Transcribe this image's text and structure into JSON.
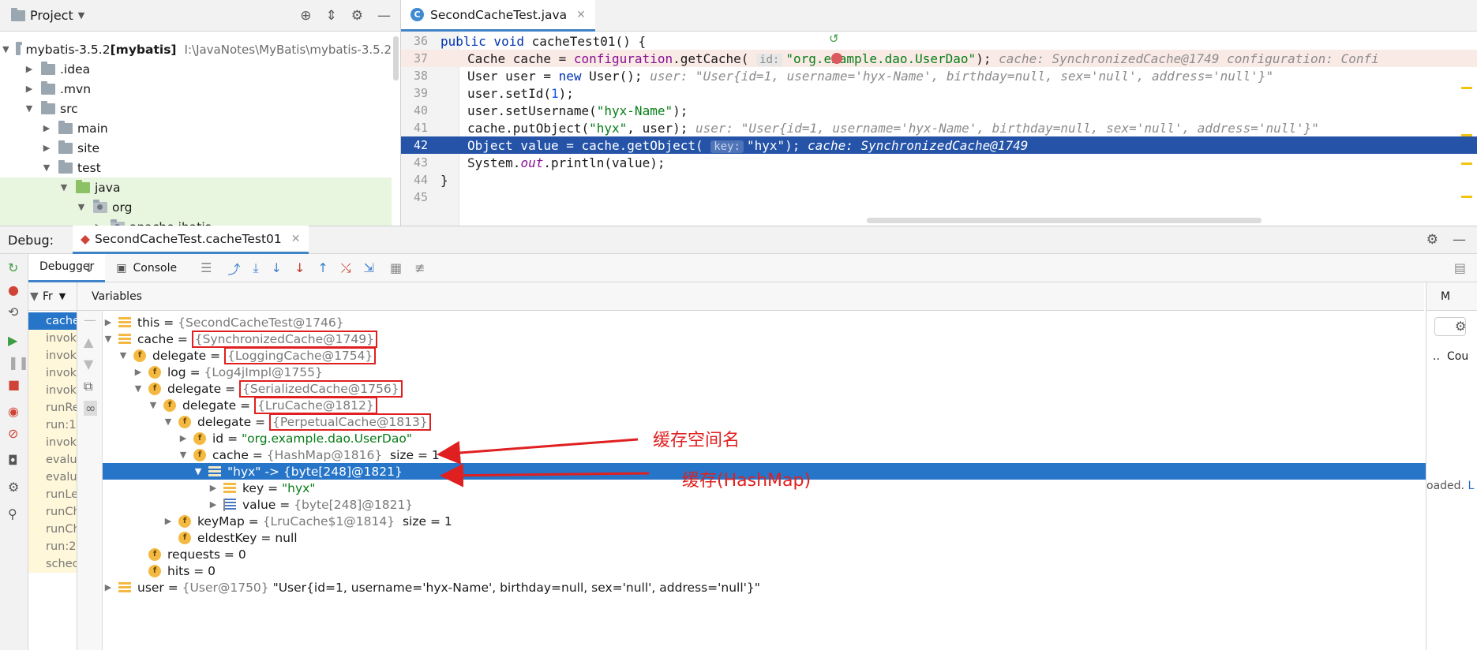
{
  "project": {
    "title": "Project",
    "tree": [
      {
        "label": "mybatis-3.5.2",
        "bold_suffix": " [mybatis]",
        "path": "I:\\JavaNotes\\MyBatis\\mybatis-3.5.2",
        "depth": 0,
        "expanded": true,
        "icon": "folder"
      },
      {
        "label": ".idea",
        "depth": 1,
        "expanded": false,
        "icon": "folder"
      },
      {
        "label": ".mvn",
        "depth": 1,
        "expanded": false,
        "icon": "folder"
      },
      {
        "label": "src",
        "depth": 1,
        "expanded": true,
        "icon": "folder"
      },
      {
        "label": "main",
        "depth": 2,
        "expanded": false,
        "icon": "folder"
      },
      {
        "label": "site",
        "depth": 2,
        "expanded": false,
        "icon": "folder"
      },
      {
        "label": "test",
        "depth": 2,
        "expanded": true,
        "icon": "folder"
      },
      {
        "label": "java",
        "depth": 3,
        "expanded": true,
        "icon": "folder-green"
      },
      {
        "label": "org",
        "depth": 4,
        "expanded": true,
        "icon": "package"
      },
      {
        "label": "apache.ibatis",
        "depth": 5,
        "expanded": false,
        "icon": "package"
      }
    ]
  },
  "editor": {
    "tab": "SecondCacheTest.java",
    "lines": [
      {
        "num": "36",
        "code": [
          [
            "kw",
            "public void "
          ],
          [
            "",
            "cacheTest01() {"
          ]
        ],
        "indent": 0
      },
      {
        "num": "37",
        "code": [
          [
            "",
            "Cache cache = "
          ],
          [
            "fld",
            "configuration"
          ],
          [
            "",
            ".getCache( "
          ],
          [
            "chip",
            "id:"
          ],
          [
            "str",
            "\"org.example.dao.UserDao\""
          ],
          [
            "",
            ");  "
          ],
          [
            "hint",
            "cache: SynchronizedCache@1749  configuration: Confi"
          ]
        ],
        "indent": 1,
        "state": "bp"
      },
      {
        "num": "38",
        "code": [
          [
            "",
            "User user = "
          ],
          [
            "kw",
            "new "
          ],
          [
            "",
            "User();  "
          ],
          [
            "hint",
            "user: \"User{id=1, username='hyx-Name', birthday=null, sex='null', address='null'}\""
          ]
        ],
        "indent": 1
      },
      {
        "num": "39",
        "code": [
          [
            "",
            "user.setId("
          ],
          [
            "num",
            "1"
          ],
          [
            "",
            ");"
          ]
        ],
        "indent": 1
      },
      {
        "num": "40",
        "code": [
          [
            "",
            "user.setUsername("
          ],
          [
            "str",
            "\"hyx-Name\""
          ],
          [
            "",
            ");"
          ]
        ],
        "indent": 1
      },
      {
        "num": "41",
        "code": [
          [
            "",
            "cache.putObject("
          ],
          [
            "str",
            "\"hyx\""
          ],
          [
            "",
            ", user);  "
          ],
          [
            "hint",
            "user: \"User{id=1, username='hyx-Name', birthday=null, sex='null', address='null'}\""
          ]
        ],
        "indent": 1
      },
      {
        "num": "42",
        "code": [
          [
            "",
            "Object value = cache.getObject( "
          ],
          [
            "chip",
            "key:"
          ],
          [
            "str",
            "\"hyx\""
          ],
          [
            "",
            ");  "
          ],
          [
            "hint",
            "cache: SynchronizedCache@1749"
          ]
        ],
        "indent": 1,
        "state": "cur"
      },
      {
        "num": "43",
        "code": [
          [
            "",
            "System."
          ],
          [
            "st",
            "out"
          ],
          [
            "",
            ".println(value);"
          ]
        ],
        "indent": 1
      },
      {
        "num": "44",
        "code": [
          [
            "",
            "}"
          ]
        ],
        "indent": 0
      },
      {
        "num": "45",
        "code": [],
        "indent": 0
      }
    ]
  },
  "debug": {
    "label": "Debug:",
    "session_tab": "SecondCacheTest.cacheTest01",
    "subtabs": {
      "debugger": "Debugger",
      "console": "Console"
    },
    "frames_header": "Fr",
    "variables_header": "Variables",
    "right_header": "M",
    "right_col": "Cou",
    "right_dots": "..",
    "right_loaded": "oaded.",
    "right_link": "L",
    "frames": [
      "cache",
      "invok",
      "invok",
      "invok",
      "invok",
      "runRe",
      "run:1",
      "invok",
      "evalu",
      "evalu",
      "runLe",
      "runCh",
      "runCh",
      "run:2",
      "schec"
    ],
    "variables": [
      {
        "depth": 0,
        "arrow": "▶",
        "icon": "list",
        "name": "this",
        "eq": " = ",
        "value": "{SecondCacheTest@1746}",
        "boxed": false
      },
      {
        "depth": 0,
        "arrow": "▼",
        "icon": "list",
        "name": "cache",
        "eq": " = ",
        "value": "{SynchronizedCache@1749}",
        "boxed": true
      },
      {
        "depth": 1,
        "arrow": "▼",
        "icon": "field",
        "name": "delegate",
        "eq": " = ",
        "value": "{LoggingCache@1754}",
        "boxed": true
      },
      {
        "depth": 2,
        "arrow": "▶",
        "icon": "field",
        "name": "log",
        "eq": " = ",
        "value": "{Log4jImpl@1755}",
        "boxed": false
      },
      {
        "depth": 2,
        "arrow": "▼",
        "icon": "field",
        "name": "delegate",
        "eq": " = ",
        "value": "{SerializedCache@1756}",
        "boxed": true
      },
      {
        "depth": 3,
        "arrow": "▼",
        "icon": "field",
        "name": "delegate",
        "eq": " = ",
        "value": "{LruCache@1812}",
        "boxed": true
      },
      {
        "depth": 4,
        "arrow": "▼",
        "icon": "field",
        "name": "delegate",
        "eq": " = ",
        "value": "{PerpetualCache@1813}",
        "boxed": true
      },
      {
        "depth": 5,
        "arrow": "▶",
        "icon": "field",
        "name": "id",
        "eq": " = ",
        "value": "\"org.example.dao.UserDao\"",
        "green": true,
        "boxed": false
      },
      {
        "depth": 5,
        "arrow": "▼",
        "icon": "field",
        "name": "cache",
        "eq": " = ",
        "value": "{HashMap@1816}",
        "suffix": "  size = 1",
        "boxed": false
      },
      {
        "depth": 6,
        "arrow": "▼",
        "icon": "list-white",
        "name": "\"hyx\" -> {byte[248]@1821}",
        "eq": "",
        "value": "",
        "boxed": false,
        "selected": true
      },
      {
        "depth": 7,
        "arrow": "▶",
        "icon": "list",
        "name": "key",
        "eq": " = ",
        "value": "\"hyx\"",
        "green": true,
        "boxed": false
      },
      {
        "depth": 7,
        "arrow": "▶",
        "icon": "array",
        "name": "value",
        "eq": " = ",
        "value": "{byte[248]@1821}",
        "boxed": false
      },
      {
        "depth": 4,
        "arrow": "▶",
        "icon": "field",
        "name": "keyMap",
        "eq": " = ",
        "value": "{LruCache$1@1814}",
        "suffix": "  size = 1",
        "boxed": false
      },
      {
        "depth": 4,
        "arrow": "",
        "icon": "field",
        "name": "eldestKey",
        "eq": " = ",
        "value": "null",
        "plain": true,
        "boxed": false
      },
      {
        "depth": 2,
        "arrow": "",
        "icon": "field",
        "name": "requests",
        "eq": " = ",
        "value": "0",
        "plain": true,
        "boxed": false
      },
      {
        "depth": 2,
        "arrow": "",
        "icon": "field",
        "name": "hits",
        "eq": " = ",
        "value": "0",
        "plain": true,
        "boxed": false
      },
      {
        "depth": 0,
        "arrow": "▶",
        "icon": "list",
        "name": "user",
        "eq": " = ",
        "value": "{User@1750}",
        "suffix": " \"User{id=1, username='hyx-Name', birthday=null, sex='null', address='null'}\"",
        "boxed": false
      }
    ]
  },
  "annotations": {
    "cache_namespace": "缓存空间名",
    "cache_hashmap": "缓存(HashMap)",
    "color": "#e02020"
  }
}
